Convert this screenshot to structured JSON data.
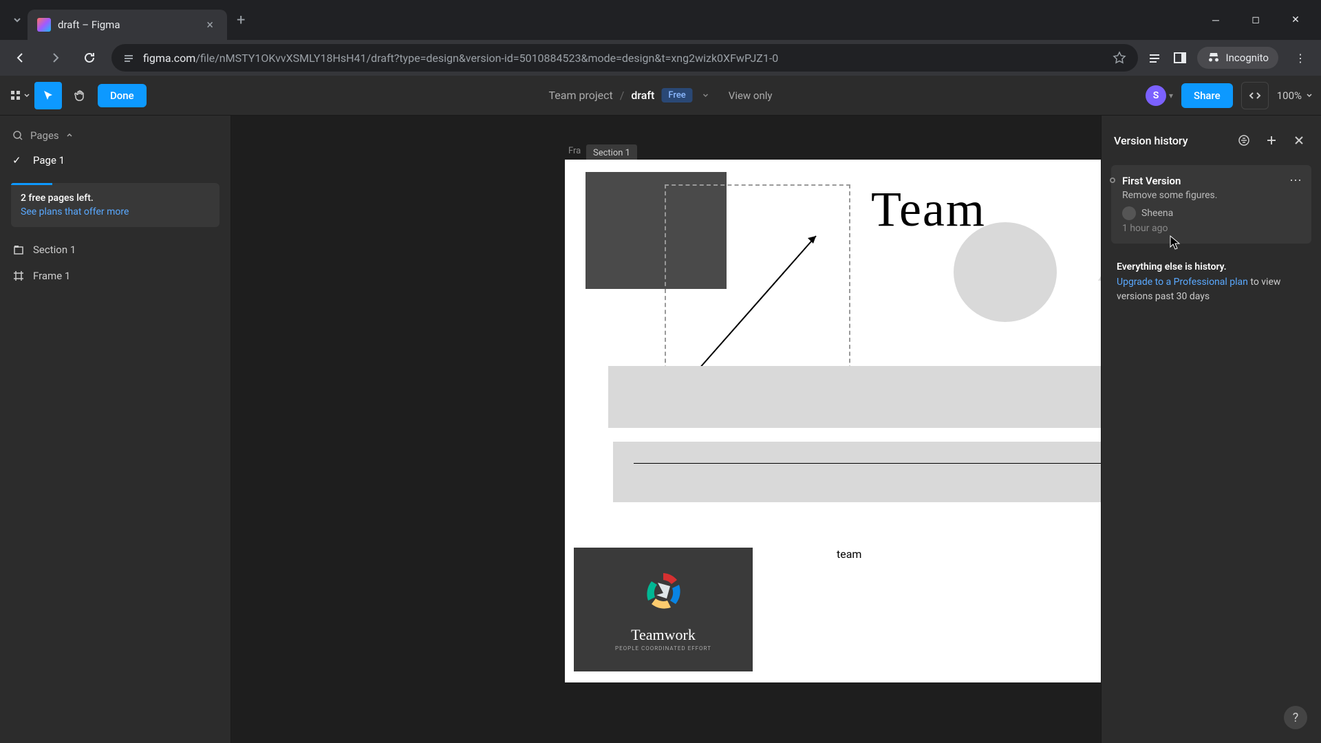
{
  "browser": {
    "tab_title": "draft – Figma",
    "url_domain": "figma.com",
    "url_path": "/file/nMSTY1OKvvXSMLY18HsH41/draft?type=design&version-id=5010884523&mode=design&t=xng2wizk0XFwPJZ1-0",
    "incognito_label": "Incognito"
  },
  "toolbar": {
    "done_label": "Done",
    "project": "Team project",
    "file": "draft",
    "badge": "Free",
    "view_mode": "View only",
    "avatar_initial": "S",
    "share_label": "Share",
    "zoom": "100%"
  },
  "left": {
    "pages_label": "Pages",
    "page_name": "Page 1",
    "banner_title": "2 free pages left.",
    "banner_link": "See plans that offer more",
    "layers": [
      {
        "name": "Section 1",
        "icon": "section"
      },
      {
        "name": "Frame 1",
        "icon": "frame"
      }
    ]
  },
  "canvas": {
    "frame_label": "Fra",
    "section_label": "Section 1",
    "hand_text": "Team",
    "team_label": "team",
    "logo_text": "Teamwork",
    "logo_sub": "PEOPLE COORDINATED EFFORT"
  },
  "right": {
    "title": "Version history",
    "version": {
      "name": "First Version",
      "desc": "Remove some figures.",
      "author": "Sheena",
      "time": "1 hour ago"
    },
    "note_title": "Everything else is history.",
    "note_link": "Upgrade to a Professional plan",
    "note_rest": " to view versions past 30 days"
  }
}
